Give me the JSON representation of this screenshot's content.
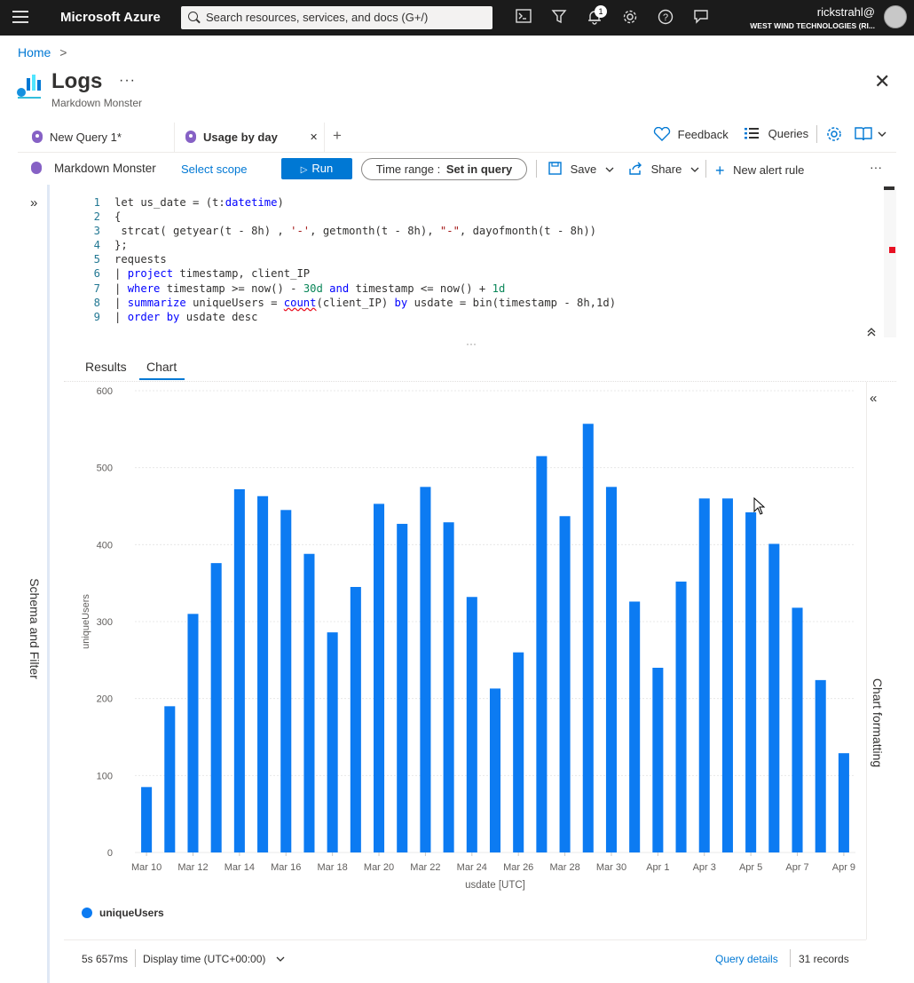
{
  "topbar": {
    "brand": "Microsoft Azure",
    "search_placeholder": "Search resources, services, and docs (G+/)",
    "notifications_count": "1",
    "user_name": "rickstrahl@",
    "user_org": "WEST WIND TECHNOLOGIES (RI..."
  },
  "breadcrumb": {
    "home": "Home",
    "separator": ">"
  },
  "header": {
    "title": "Logs",
    "more": "···",
    "subtitle": "Markdown Monster",
    "close": "✕"
  },
  "tabs": [
    {
      "label": "New Query 1*"
    },
    {
      "label": "Usage by day",
      "close": "✕"
    }
  ],
  "tab_add": "+",
  "tab_actions": {
    "feedback": "Feedback",
    "queries": "Queries"
  },
  "toolbar": {
    "scope_name": "Markdown Monster",
    "select_scope": "Select scope",
    "run": "Run",
    "time_range_label": "Time range :",
    "time_range_value": "Set in query",
    "save": "Save",
    "share": "Share",
    "new_alert": "New alert rule",
    "more": "···"
  },
  "left_panel": {
    "label": "Schema and Filter"
  },
  "right_panel": {
    "label": "Chart formatting"
  },
  "editor": {
    "line_numbers": [
      "1",
      "2",
      "3",
      "4",
      "5",
      "6",
      "7",
      "8",
      "9"
    ]
  },
  "results_tabs": {
    "results": "Results",
    "chart": "Chart"
  },
  "chart_data": {
    "type": "bar",
    "categories": [
      "Mar 10",
      "Mar 11",
      "Mar 12",
      "Mar 13",
      "Mar 14",
      "Mar 15",
      "Mar 16",
      "Mar 17",
      "Mar 18",
      "Mar 19",
      "Mar 20",
      "Mar 21",
      "Mar 22",
      "Mar 23",
      "Mar 24",
      "Mar 25",
      "Mar 26",
      "Mar 27",
      "Mar 28",
      "Mar 29",
      "Mar 30",
      "Mar 31",
      "Apr 1",
      "Apr 2",
      "Apr 3",
      "Apr 4",
      "Apr 5",
      "Apr 6",
      "Apr 7",
      "Apr 8",
      "Apr 9"
    ],
    "tick_labels": [
      "Mar 10",
      "Mar 12",
      "Mar 14",
      "Mar 16",
      "Mar 18",
      "Mar 20",
      "Mar 22",
      "Mar 24",
      "Mar 26",
      "Mar 28",
      "Mar 30",
      "Apr 1",
      "Apr 3",
      "Apr 5",
      "Apr 7",
      "Apr 9"
    ],
    "series": [
      {
        "name": "uniqueUsers",
        "values": [
          85,
          190,
          310,
          376,
          472,
          463,
          445,
          388,
          286,
          345,
          453,
          427,
          475,
          429,
          332,
          213,
          260,
          515,
          437,
          557,
          475,
          326,
          240,
          352,
          460,
          460,
          442,
          401,
          318,
          224,
          129
        ]
      }
    ],
    "xlabel": "usdate [UTC]",
    "ylabel": "uniqueUsers",
    "ylim": [
      0,
      600
    ],
    "yticks": [
      0,
      100,
      200,
      300,
      400,
      500,
      600
    ],
    "grid": true,
    "color": "#0c7bf2"
  },
  "legend": {
    "label": "uniqueUsers"
  },
  "status": {
    "duration": "5s 657ms",
    "display_time": "Display time (UTC+00:00)",
    "query_details": "Query details",
    "records": "31 records"
  }
}
